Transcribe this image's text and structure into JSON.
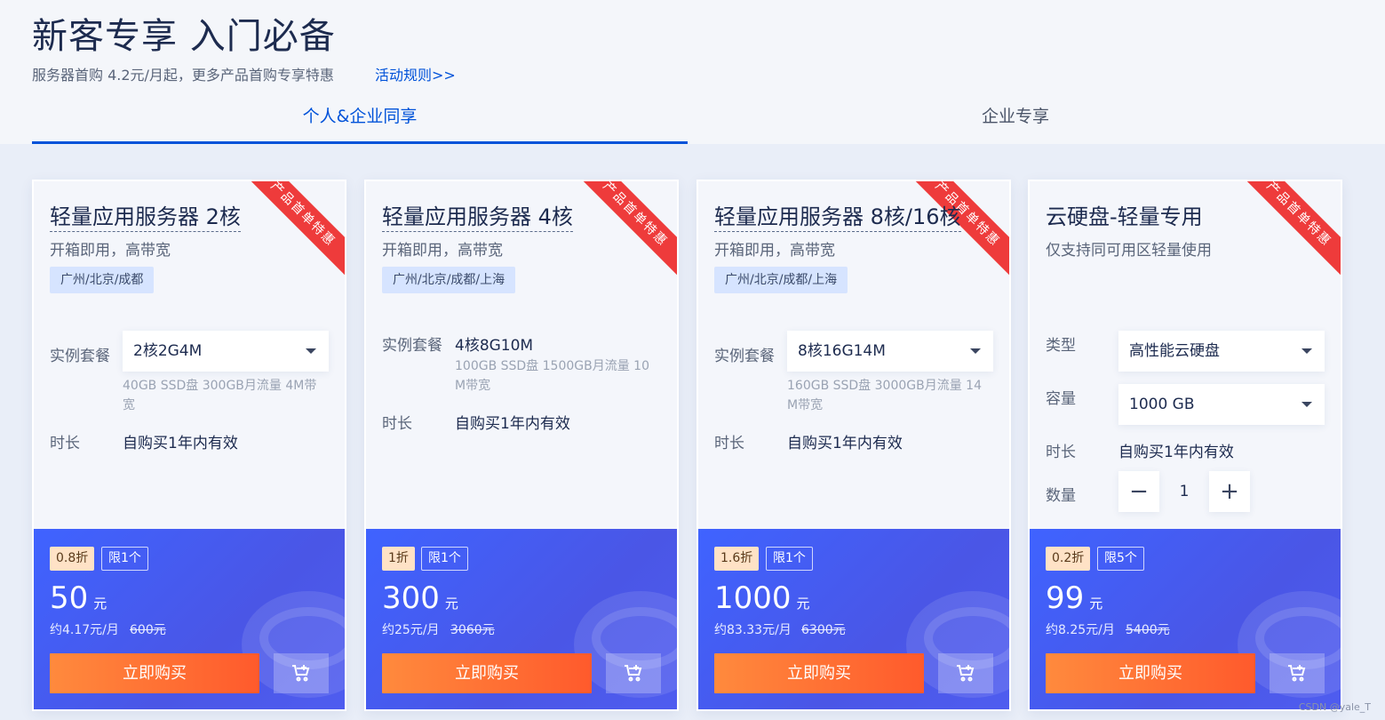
{
  "header": {
    "title": "新客专享 入门必备",
    "subtitle": "服务器首购 4.2元/月起，更多产品首购专享特惠",
    "rules_link": "活动规则>>"
  },
  "tabs": [
    {
      "label": "个人&企业同享",
      "active": true
    },
    {
      "label": "企业专享",
      "active": false
    }
  ],
  "ribbon_text": "产品首单特惠",
  "cards": [
    {
      "name": "轻量应用服务器 2核",
      "desc": "开箱即用，高带宽",
      "region": "广州/北京/成都",
      "spec_label": "实例套餐",
      "spec_value": "2核2G4M",
      "spec_note_1": "40GB SSD盘 300GB月流量 4M带",
      "spec_note_2": "宽",
      "duration_label": "时长",
      "duration_value": "自购买1年内有效",
      "discount": "0.8折",
      "limit": "限1个",
      "price": "50",
      "price_unit": "元",
      "per_month": "约4.17元/月",
      "original": "600元",
      "buy_label": "立即购买"
    },
    {
      "name": "轻量应用服务器 4核",
      "desc": "开箱即用，高带宽",
      "region": "广州/北京/成都/上海",
      "spec_label": "实例套餐",
      "spec_value": "4核8G10M",
      "spec_note_1": "100GB SSD盘 1500GB月流量 10",
      "spec_note_2": "M带宽",
      "duration_label": "时长",
      "duration_value": "自购买1年内有效",
      "discount": "1折",
      "limit": "限1个",
      "price": "300",
      "price_unit": "元",
      "per_month": "约25元/月",
      "original": "3060元",
      "buy_label": "立即购买"
    },
    {
      "name": "轻量应用服务器 8核/16核",
      "desc": "开箱即用，高带宽",
      "region": "广州/北京/成都/上海",
      "spec_label": "实例套餐",
      "spec_value": "8核16G14M",
      "spec_note_1": "160GB SSD盘 3000GB月流量 14",
      "spec_note_2": "M带宽",
      "duration_label": "时长",
      "duration_value": "自购买1年内有效",
      "discount": "1.6折",
      "limit": "限1个",
      "price": "1000",
      "price_unit": "元",
      "per_month": "约83.33元/月",
      "original": "6300元",
      "buy_label": "立即购买"
    },
    {
      "name": "云硬盘-轻量专用",
      "desc": "仅支持同可用区轻量使用",
      "type_label": "类型",
      "type_value": "高性能云硬盘",
      "capacity_label": "容量",
      "capacity_value": "1000 GB",
      "duration_label": "时长",
      "duration_value": "自购买1年内有效",
      "qty_label": "数量",
      "qty_value": "1",
      "qty_minus": "−",
      "qty_plus": "+",
      "discount": "0.2折",
      "limit": "限5个",
      "price": "99",
      "price_unit": "元",
      "per_month": "约8.25元/月",
      "original": "5400元",
      "buy_label": "立即购买"
    }
  ],
  "watermark": "CSDN @yale_T",
  "colors": {
    "accent": "#0052d9",
    "ribbon": "#ee3b3b",
    "buy_button": "#ff6a2f",
    "price_panel": "#4358f0"
  }
}
